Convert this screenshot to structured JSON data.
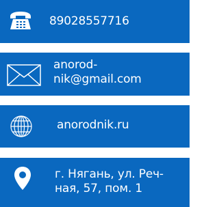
{
  "contacts": {
    "phone": {
      "icon": "telephone-icon",
      "text": "89028557716"
    },
    "email": {
      "icon": "envelope-icon",
      "line1": "anorod-",
      "line2": "nik@gmail.com"
    },
    "website": {
      "icon": "globe-icon",
      "text": "anorodnik.ru"
    },
    "address": {
      "icon": "location-pin-icon",
      "line1": "г. Нягань, ул. Реч-",
      "line2": "ная, 57, пом. 1"
    }
  },
  "colors": {
    "card_bg": "#0a68bf",
    "text": "#ffffff"
  }
}
